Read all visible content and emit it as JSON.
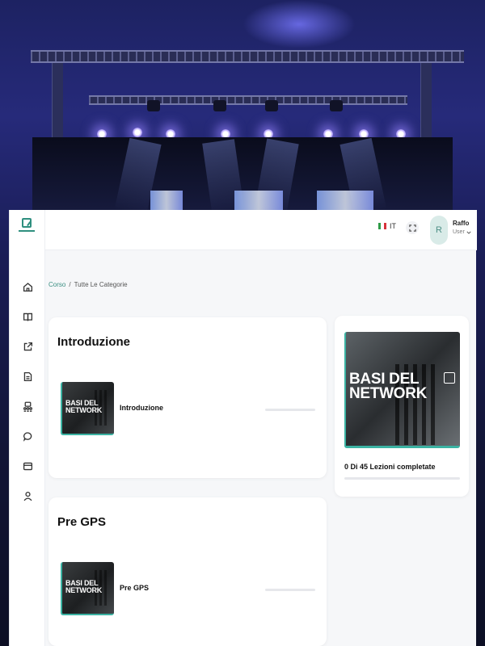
{
  "topbar": {
    "language": "IT",
    "avatar_initial": "R",
    "user_name": "Raffo",
    "user_role": "User"
  },
  "breadcrumb": {
    "link": "Corso",
    "separator": "/",
    "current": "Tutte Le Categorie"
  },
  "sections": [
    {
      "title": "Introduzione",
      "lesson": {
        "thumb_text": "BASI DEL NETWORK",
        "name": "Introduzione",
        "progress": 0
      }
    },
    {
      "title": "Pre GPS",
      "lesson": {
        "thumb_text": "BASI DEL NETWORK",
        "name": "Pre GPS",
        "progress": 0
      }
    }
  ],
  "course_summary": {
    "thumb_text": "BASI DEL NETWORK",
    "status": "0 Di 45 Lezioni completate",
    "progress": 0
  },
  "nav_icons": [
    "home-icon",
    "book-icon",
    "external-link-icon",
    "document-icon",
    "users-icon",
    "chat-icon",
    "card-icon",
    "user-icon"
  ],
  "colors": {
    "accent": "#3a8f82",
    "thumb_border": "#3bb3a3",
    "avatar_bg": "#d9ebe8"
  }
}
